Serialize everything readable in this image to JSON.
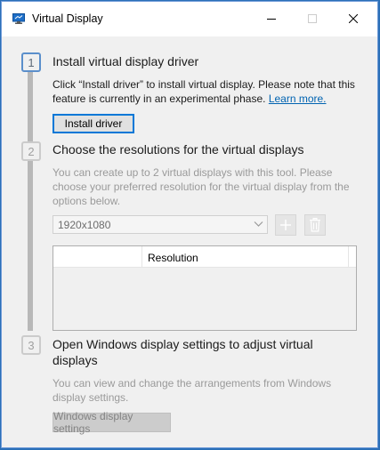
{
  "window": {
    "title": "Virtual Display"
  },
  "steps": [
    {
      "number": "1",
      "heading": "Install virtual display driver",
      "description": "Click “Install driver” to install virtual display. Please note that this feature is currently in an experimental phase.",
      "link_text": "Learn more.",
      "button_label": "Install driver"
    },
    {
      "number": "2",
      "heading": "Choose the resolutions for the virtual displays",
      "description": "You can create up to 2 virtual displays with this tool.  Please choose your preferred resolution for the virtual display from the options below.",
      "select_value": "1920x1080",
      "table_columns": [
        "",
        "Resolution",
        ""
      ]
    },
    {
      "number": "3",
      "heading": "Open Windows display settings to adjust virtual displays",
      "description": "You can view and change the arrangements from Windows display settings.",
      "button_label": "Windows display settings"
    }
  ],
  "colors": {
    "accent": "#0078d7",
    "link": "#0063b1",
    "step_active": "#5b8fcb",
    "step_inactive": "#cbcbcb"
  },
  "icons": {
    "app": "display-icon",
    "minimize": "minimize-icon",
    "maximize": "maximize-icon",
    "close": "close-icon",
    "dropdown": "chevron-down-icon",
    "add": "plus-icon",
    "delete": "trash-icon"
  }
}
